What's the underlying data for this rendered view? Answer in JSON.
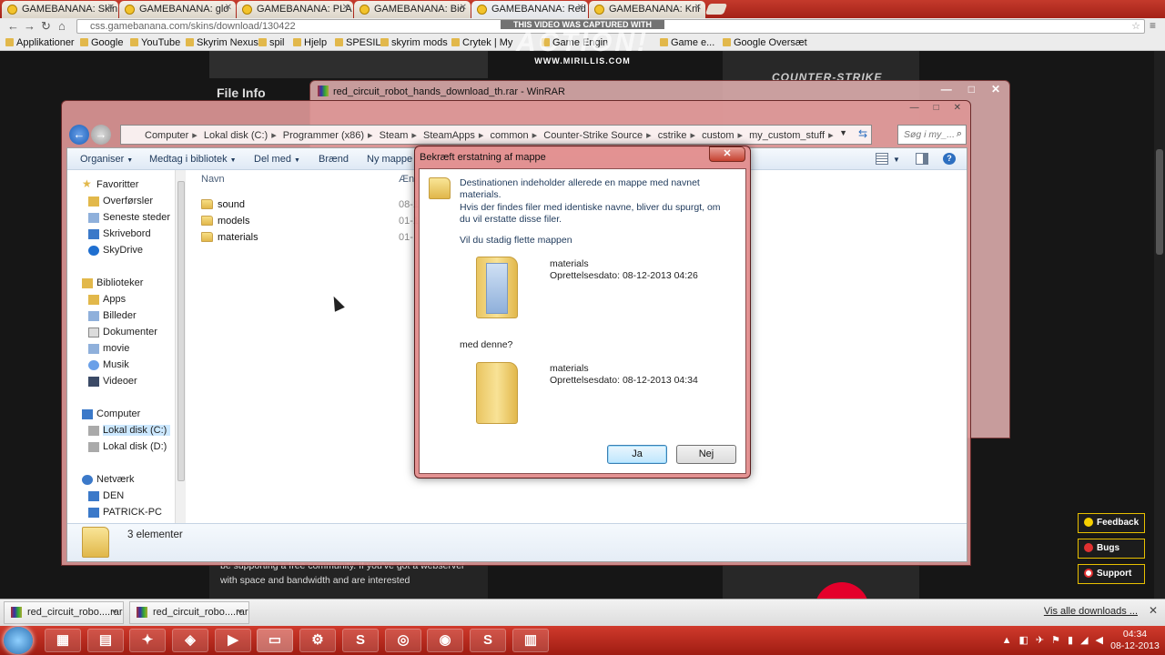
{
  "browser": {
    "tabs": [
      {
        "label": "GAMEBANANA: Skin",
        "active": false
      },
      {
        "label": "GAMEBANANA: glo",
        "active": false
      },
      {
        "label": "GAMEBANANA: PLA",
        "active": false
      },
      {
        "label": "GAMEBANANA: Bio",
        "active": false
      },
      {
        "label": "GAMEBANANA: Red",
        "active": true
      },
      {
        "label": "GAMEBANANA: Kni",
        "active": false
      }
    ],
    "url": "css.gamebanana.com/skins/download/130422",
    "bookmarks": [
      "Applikationer",
      "Google",
      "YouTube",
      "Skyrim Nexus",
      "spil",
      "Hjelp",
      "SPESIL",
      "skyrim mods",
      "Crytek | My",
      "Game Engin",
      "Game e...",
      "Google Oversæt"
    ]
  },
  "capture_overlay": {
    "line1": "THIS VIDEO WAS CAPTURED WITH",
    "logo": "ACTION!",
    "line3": "WWW.MIRILLIS.COM"
  },
  "webpage": {
    "file_info": "File Info",
    "cs_logo": "COUNTER-STRIKE",
    "body_text": "be supporting a free community. If you've got a webserver with space and bandwidth and are interested",
    "side_buttons": [
      "Feedback",
      "Bugs",
      "Support"
    ]
  },
  "winrar": {
    "title": "red_circuit_robot_hands_download_th.rar - WinRAR"
  },
  "explorer": {
    "breadcrumb": [
      "Computer",
      "Lokal disk (C:)",
      "Programmer (x86)",
      "Steam",
      "SteamApps",
      "common",
      "Counter-Strike Source",
      "cstrike",
      "custom",
      "my_custom_stuff"
    ],
    "search_placeholder": "Søg i my_...",
    "toolbar": [
      "Organiser",
      "Medtag i bibliotek",
      "Del med",
      "Brænd",
      "Ny mappe"
    ],
    "nav": {
      "favorites": "Favoritter",
      "favorites_items": [
        "Overførsler",
        "Seneste steder",
        "Skrivebord",
        "SkyDrive"
      ],
      "libraries": "Biblioteker",
      "libraries_items": [
        "Apps",
        "Billeder",
        "Dokumenter",
        "movie",
        "Musik",
        "Videoer"
      ],
      "computer": "Computer",
      "computer_items": [
        "Lokal disk (C:)",
        "Lokal disk (D:)"
      ],
      "network": "Netværk",
      "network_items": [
        "DEN",
        "PATRICK-PC"
      ]
    },
    "columns": {
      "name": "Navn",
      "date": "Æn"
    },
    "files": [
      {
        "name": "sound",
        "date": "08-1"
      },
      {
        "name": "models",
        "date": "01-1"
      },
      {
        "name": "materials",
        "date": "01-"
      }
    ],
    "status": "3 elementer"
  },
  "dialog": {
    "title": "Bekræft erstatning af mappe",
    "close": "✕",
    "line1": "Destinationen indeholder allerede en mappe med navnet materials.",
    "line2": "Hvis der findes filer med identiske navne, bliver du spurgt, om du vil erstatte disse filer.",
    "line3": "Vil du stadig flette mappen",
    "existing": {
      "name": "materials",
      "created": "Oprettelsesdato: 08-12-2013 04:26"
    },
    "with_this": "med denne?",
    "new": {
      "name": "materials",
      "created": "Oprettelsesdato: 08-12-2013 04:34"
    },
    "yes": "Ja",
    "no": "Nej"
  },
  "downloads": {
    "items": [
      "red_circuit_robo....rar",
      "red_circuit_robo....rar"
    ],
    "show_all": "Vis alle downloads ...",
    "close": "✕"
  },
  "taskbar": {
    "time": "04:34",
    "date": "08-12-2013"
  }
}
